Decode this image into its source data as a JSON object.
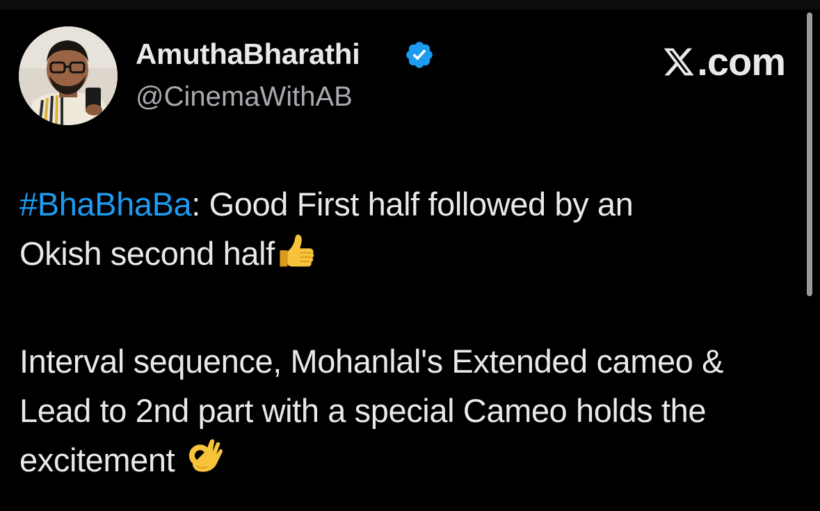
{
  "author": {
    "display_name": "AmuthaBharathi",
    "handle": "@CinemaWithAB",
    "verified_icon": "verified-badge-icon",
    "verified_color": "#1d9bf0"
  },
  "brand": {
    "icon": "x-logo-icon",
    "text": ".com"
  },
  "tweet": {
    "hashtag": "#BhaBhaBa",
    "line1_rest": ": Good First half followed by an",
    "line2": "Okish second half",
    "line2_emoji": "thumbs-up-emoji",
    "para2": "Interval sequence, Mohanlal's Extended cameo & Lead to 2nd part with a special Cameo holds the excitement ",
    "para2_emoji": "ok-hand-emoji"
  },
  "colors": {
    "background": "#000000",
    "text": "#e7e9ea",
    "handle": "#a7abb0",
    "link": "#1d9bf0"
  }
}
